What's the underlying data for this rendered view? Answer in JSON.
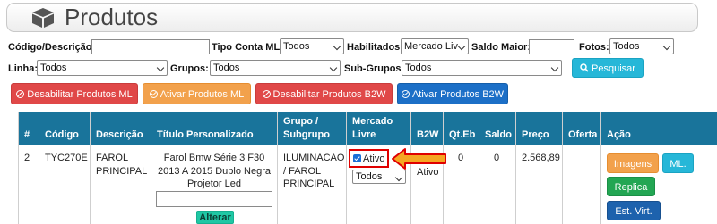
{
  "page": {
    "title": "Produtos"
  },
  "filters": {
    "codigo_label": "Código/Descrição:",
    "codigo_value": "",
    "tipo_label": "Tipo Conta ML:",
    "tipo_value": "Todos",
    "habilitados_label": "Habilitados:",
    "habilitados_value": "Mercado Liv",
    "saldo_label": "Saldo Maior:",
    "saldo_value": "",
    "fotos_label": "Fotos:",
    "fotos_value": "Todos",
    "linha_label": "Linha:",
    "linha_value": "Todos",
    "grupos_label": "Grupos:",
    "grupos_value": "Todos",
    "subgrupos_label": "Sub-Grupos:",
    "subgrupos_value": "Todos",
    "search_label": "Pesquisar"
  },
  "actions": {
    "disable_ml": "Desabilitar Produtos ML",
    "enable_ml": "Ativar Produtos ML",
    "disable_b2w": "Desabilitar Produtos B2W",
    "enable_b2w": "Ativar Produtos B2W"
  },
  "table": {
    "headers": {
      "num": "#",
      "codigo": "Código",
      "descricao": "Descrição",
      "titulo": "Título Personalizado",
      "grupo_l1": "Grupo /",
      "grupo_l2": "Subgrupo",
      "mercado_l1": "Mercado",
      "mercado_l2": "Livre",
      "b2w": "B2W",
      "qteb": "Qt.Eb",
      "saldo": "Saldo",
      "preco": "Preço",
      "oferta": "Oferta",
      "acao": "Ação"
    },
    "row": {
      "num": "2",
      "codigo": "TYC270E",
      "descricao_l1": "FAROL",
      "descricao_l2": "PRINCIPAL",
      "titulo_l1": "Farol Bmw Série 3 F30",
      "titulo_l2": "2013 A 2015 Duplo Negra",
      "titulo_l3": "Projetor Led",
      "titulo_input": "",
      "alterar": "Alterar",
      "grupo_l1": "ILUMINACAO",
      "grupo_l2": "/ FAROL",
      "grupo_l3": "PRINCIPAL",
      "ml_status": "Ativo",
      "ml_checked": true,
      "ml_select": "Todos",
      "b2w_status": "Ativo",
      "qteb": "0",
      "saldo": "0",
      "preco": "2.568,89",
      "oferta": "",
      "btn_imagens": "Imagens",
      "btn_ml": "ML.",
      "btn_replica": "Replica",
      "btn_est": "Est. Virt."
    }
  },
  "colors": {
    "header_bg": "#19749b",
    "danger": "#e04848",
    "warning": "#f2a14c",
    "primary": "#1c6fc7",
    "info": "#26b7d8",
    "success": "#23a653",
    "highlight": "#e00000",
    "arrow": "#f5a623"
  },
  "icons": {
    "title": "box-icon",
    "search": "search-icon",
    "disable": "ban-icon",
    "enable": "check-circle-icon",
    "pointer": "arrow-left-icon"
  }
}
